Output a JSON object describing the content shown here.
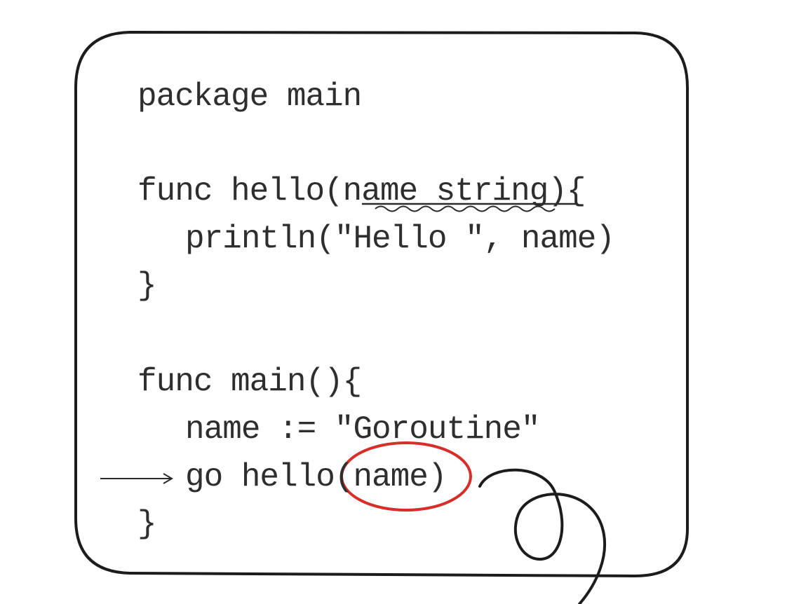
{
  "code": {
    "lines": [
      "package main",
      "func hello(name string){",
      "println(\"Hello \", name)",
      "}",
      "func main(){",
      "name := \"Goroutine\"",
      "go hello(name)",
      "}"
    ]
  },
  "annotations": {
    "underline_target": "name string",
    "circled_target": "(name)",
    "arrow_target": "go hello(name)"
  },
  "colors": {
    "ink": "#2e2e2e",
    "frame": "#1c1c1c",
    "highlight": "#d62f2a",
    "background": "#ffffff"
  }
}
